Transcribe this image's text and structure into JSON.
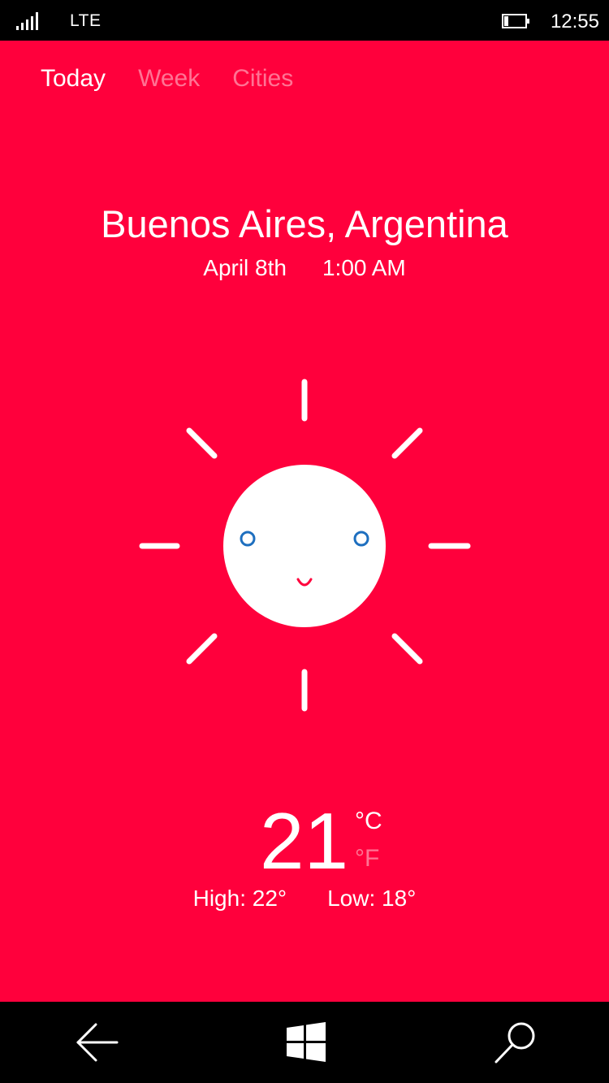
{
  "status_bar": {
    "network": "LTE",
    "clock": "12:55"
  },
  "tabs": [
    {
      "label": "Today",
      "active": true
    },
    {
      "label": "Week",
      "active": false
    },
    {
      "label": "Cities",
      "active": false
    }
  ],
  "location": {
    "city": "Buenos Aires, Argentina",
    "date": "April 8th",
    "time": "1:00 AM"
  },
  "weather": {
    "condition_icon": "sun-face-icon",
    "temperature": "21",
    "unit_celsius": "°C",
    "unit_fahrenheit": "°F",
    "selected_unit": "celsius",
    "high": "High: 22°",
    "low": "Low: 18°"
  },
  "colors": {
    "background": "#FF003C",
    "eye": "#1E6FBF",
    "mouth": "#FF003C",
    "text": "#FFFFFF"
  },
  "nav_bar": {
    "back_icon": "back-arrow-icon",
    "home_icon": "windows-logo-icon",
    "search_icon": "search-icon"
  }
}
